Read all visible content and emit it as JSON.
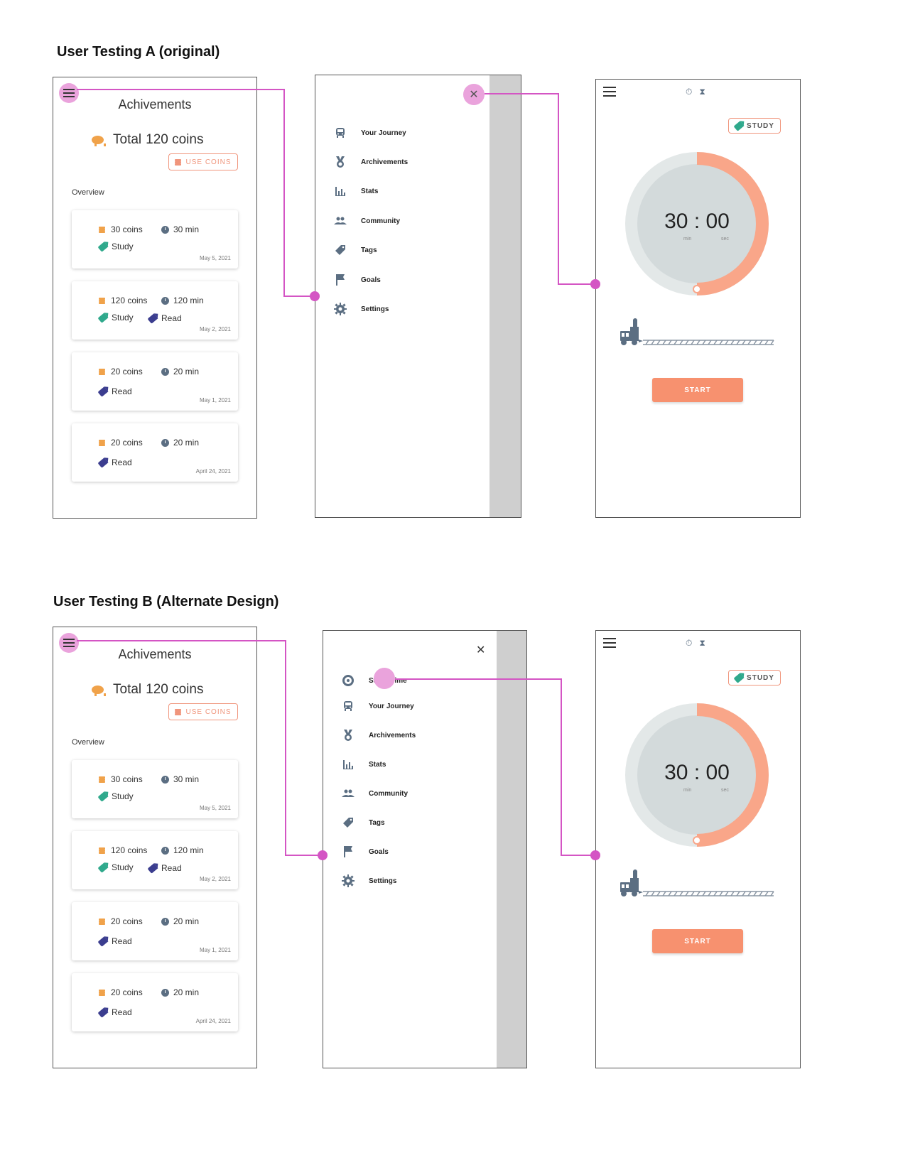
{
  "sectionA": {
    "title": "User Testing A (original)"
  },
  "sectionB": {
    "title": "User Testing B (Alternate Design)"
  },
  "achievements": {
    "title": "Achivements",
    "total_label": "Total",
    "total_value": "120 coins",
    "use_coins": "USE COINS",
    "overview": "Overview",
    "cards": [
      {
        "coins": "30 coins",
        "time": "30 min",
        "tags": [
          "Study"
        ],
        "date": "May 5, 2021"
      },
      {
        "coins": "120 coins",
        "time": "120 min",
        "tags": [
          "Study",
          "Read"
        ],
        "date": "May 2, 2021"
      },
      {
        "coins": "20 coins",
        "time": "20 min",
        "tags": [
          "Read"
        ],
        "date": "May 1, 2021"
      },
      {
        "coins": "20 coins",
        "time": "20 min",
        "tags": [
          "Read"
        ],
        "date": "April 24, 2021"
      }
    ]
  },
  "drawerA": {
    "items": [
      "Your Journey",
      "Archivements",
      "Stats",
      "Community",
      "Tags",
      "Goals",
      "Settings"
    ]
  },
  "drawerB": {
    "items": [
      "Study Time",
      "Your Journey",
      "Archivements",
      "Stats",
      "Community",
      "Tags",
      "Goals",
      "Settings"
    ]
  },
  "timer": {
    "chip": "STUDY",
    "time": "30 : 00",
    "min_label": "min",
    "sec_label": "sec",
    "start": "START",
    "progress": 0.5
  },
  "colors": {
    "accent": "#f7916f",
    "highlight": "#eaa3dc",
    "connector": "#d455c4",
    "study_tag": "#2fa98c",
    "read_tag": "#3b3d8f",
    "coin": "#f0a24a"
  }
}
